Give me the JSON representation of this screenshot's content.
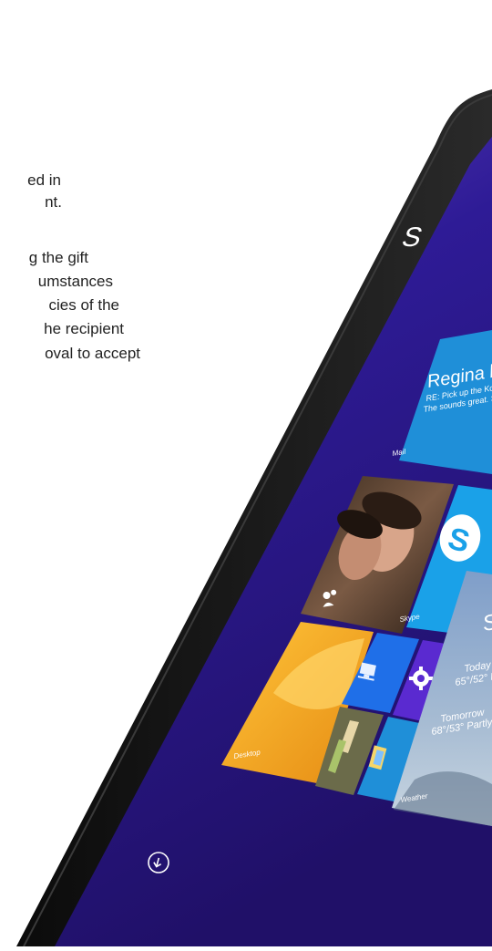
{
  "text_block": {
    "lines": [
      "ed in",
      "nt.",
      "g the gift",
      "umstances",
      "cies of the",
      "he recipient",
      "oval to accept"
    ]
  },
  "tablet": {
    "start_title": "S",
    "mail_tile": {
      "sender": "Regina h",
      "line1": "RE: Pick up the Ko",
      "line2": "The sounds great. S",
      "label": "Mail"
    },
    "skype_tile": {
      "label": "Skype"
    },
    "desktop_tile": {
      "label": "Desktop"
    },
    "weather_tile": {
      "label": "Weather",
      "city": "S",
      "today": "Today",
      "today_temp": "65°/52° M",
      "tomorrow": "Tomorrow",
      "tomorrow_temp": "68°/53° Partly su"
    },
    "colors": {
      "screen": "#2b1a8a",
      "bezel": "#151515",
      "mail": "#1f8fd8",
      "skype": "#1aa1e8",
      "desktop": "#f2a51a",
      "pc": "#1f6fe8",
      "settings": "#5a2ad0"
    },
    "icons": [
      "people-icon",
      "skype-icon",
      "pc-icon",
      "settings-icon",
      "photos-icon",
      "all-apps-arrow-icon"
    ]
  }
}
